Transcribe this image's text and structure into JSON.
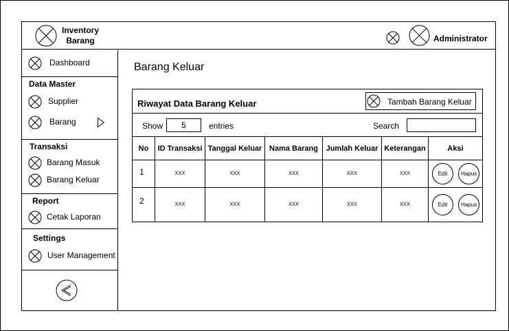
{
  "app": {
    "title_line1": "Inventory",
    "title_line2": "Barang",
    "user": "Administrator"
  },
  "sidebar": {
    "dashboard": "Dashboard",
    "data_master": {
      "title": "Data Master",
      "items": [
        "Supplier",
        "Barang"
      ]
    },
    "transaksi": {
      "title": "Transaksi",
      "items": [
        "Barang Masuk",
        "Barang Keluar"
      ]
    },
    "report": {
      "title": "Report",
      "items": [
        "Cetak Laporan"
      ]
    },
    "settings": {
      "title": "Settings",
      "items": [
        "User Management"
      ]
    }
  },
  "main": {
    "page_title": "Barang Keluar",
    "panel_title": "Riwayat Data Barang Keluar",
    "add_button": "Tambah Barang Keluar",
    "show_label": "Show",
    "entries_value": "5",
    "entries_label": "entries",
    "search_label": "Search",
    "search_value": "",
    "table": {
      "columns": [
        "No",
        "ID Transaksi",
        "Tanggal Keluar",
        "Nama Barang",
        "Jumlah Keluar",
        "Keterangan",
        "Aksi"
      ],
      "rows": [
        {
          "no": "1",
          "cells": [
            "xxx",
            "xxx",
            "xxx",
            "xxx",
            "xxx"
          ],
          "edit": "Edit",
          "hapus": "Hapus"
        },
        {
          "no": "2",
          "cells": [
            "xxx",
            "xxx",
            "xxx",
            "xxx",
            "xxx"
          ],
          "edit": "Edit",
          "hapus": "Hapus"
        }
      ]
    }
  }
}
